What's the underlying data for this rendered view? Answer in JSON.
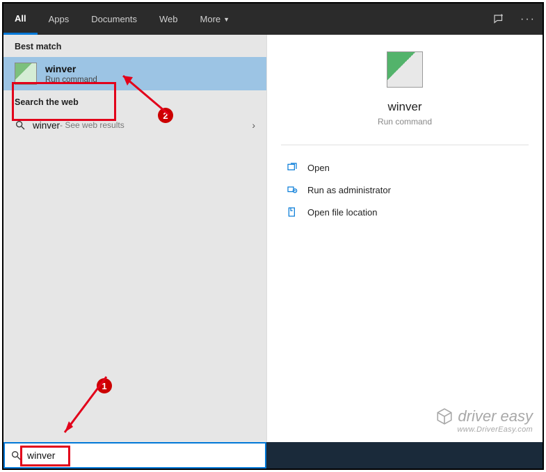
{
  "tabs": {
    "all": "All",
    "apps": "Apps",
    "documents": "Documents",
    "web": "Web",
    "more": "More"
  },
  "left": {
    "best_match_header": "Best match",
    "best_match": {
      "title": "winver",
      "subtitle": "Run command"
    },
    "search_web_header": "Search the web",
    "web_result": {
      "term": "winver",
      "hint": " - See web results"
    }
  },
  "right": {
    "title": "winver",
    "subtitle": "Run command",
    "actions": {
      "open": "Open",
      "run_admin": "Run as administrator",
      "open_location": "Open file location"
    }
  },
  "search": {
    "value": "winver"
  },
  "annotations": {
    "one": "1",
    "two": "2"
  },
  "watermark": {
    "brand": "driver easy",
    "url": "www.DriverEasy.com"
  }
}
